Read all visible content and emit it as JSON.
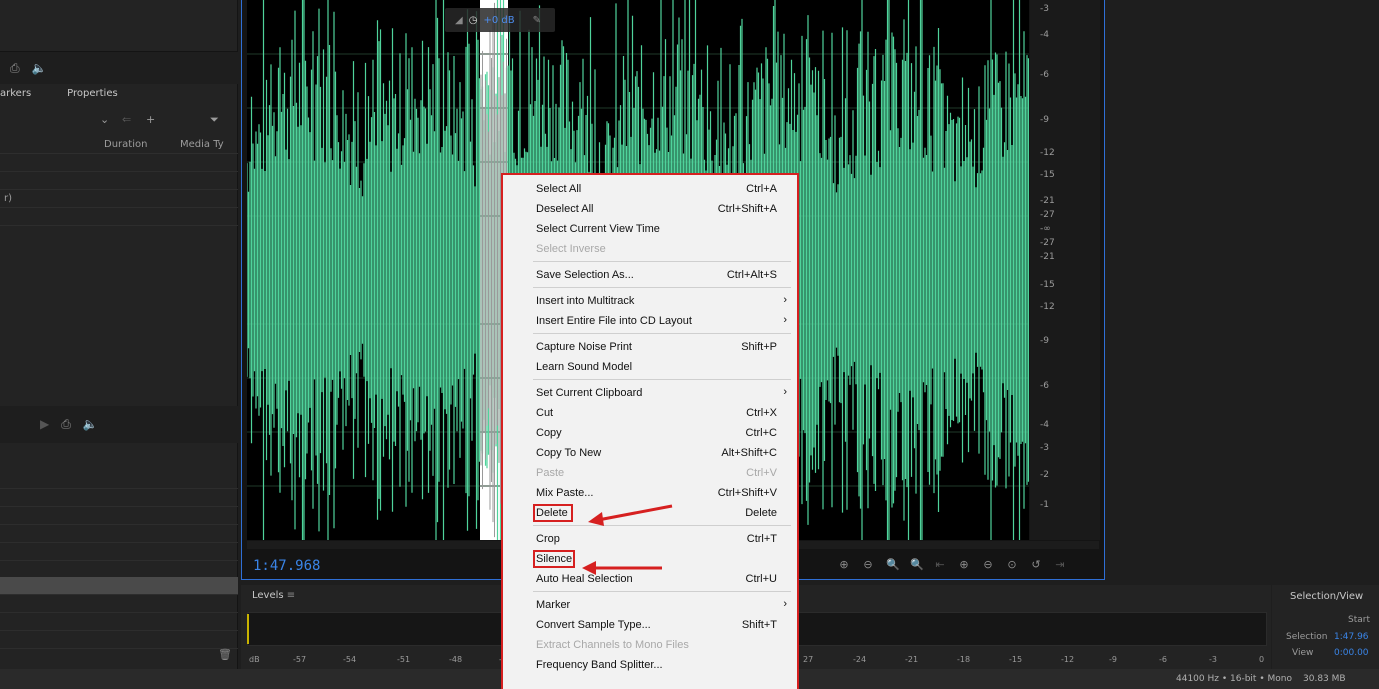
{
  "left_panel": {
    "tabs": [
      "arkers",
      "Properties"
    ],
    "columns": {
      "duration": "Duration",
      "media_type": "Media Ty"
    },
    "file_row_text": "r)"
  },
  "editor": {
    "hud_gain": "+0 dB",
    "timecode": "1:47.968",
    "ruler_labels": [
      "-3",
      "-4",
      "-6",
      "-9",
      "-12",
      "-15",
      "-21",
      "-27",
      "-∞",
      "-27",
      "-21",
      "-15",
      "-12",
      "-9",
      "-6",
      "-4",
      "-3",
      "-2",
      "-1"
    ],
    "waveform_color": "#4fd39b"
  },
  "levels": {
    "title": "Levels",
    "scale": [
      "dB",
      "-57",
      "-54",
      "-51",
      "-48",
      "-4",
      "27",
      "-24",
      "-21",
      "-18",
      "-15",
      "-12",
      "-9",
      "-6",
      "-3",
      "0"
    ]
  },
  "selection_view": {
    "title": "Selection/View",
    "start_header": "Start",
    "selection_label": "Selection",
    "selection_value": "1:47.96",
    "view_label": "View",
    "view_value": "0:00.00"
  },
  "status": {
    "format": "44100 Hz • 16-bit • Mono",
    "size": "30.83 MB"
  },
  "context_menu": {
    "items": [
      {
        "label": "Select All",
        "shortcut": "Ctrl+A",
        "enabled": true
      },
      {
        "label": "Deselect All",
        "shortcut": "Ctrl+Shift+A",
        "enabled": true
      },
      {
        "label": "Select Current View Time",
        "shortcut": "",
        "enabled": true
      },
      {
        "label": "Select Inverse",
        "shortcut": "",
        "enabled": false
      },
      {
        "label": "Save Selection As...",
        "shortcut": "Ctrl+Alt+S",
        "enabled": true
      },
      {
        "label": "Insert into Multitrack",
        "shortcut": "",
        "enabled": true,
        "submenu": true
      },
      {
        "label": "Insert Entire File into CD Layout",
        "shortcut": "",
        "enabled": true,
        "submenu": true
      },
      {
        "label": "Capture Noise Print",
        "shortcut": "Shift+P",
        "enabled": true
      },
      {
        "label": "Learn Sound Model",
        "shortcut": "",
        "enabled": true
      },
      {
        "label": "Set Current Clipboard",
        "shortcut": "",
        "enabled": true,
        "submenu": true
      },
      {
        "label": "Cut",
        "shortcut": "Ctrl+X",
        "enabled": true
      },
      {
        "label": "Copy",
        "shortcut": "Ctrl+C",
        "enabled": true
      },
      {
        "label": "Copy To New",
        "shortcut": "Alt+Shift+C",
        "enabled": true
      },
      {
        "label": "Paste",
        "shortcut": "Ctrl+V",
        "enabled": false
      },
      {
        "label": "Mix Paste...",
        "shortcut": "Ctrl+Shift+V",
        "enabled": true
      },
      {
        "label": "Delete",
        "shortcut": "Delete",
        "enabled": true,
        "highlighted": true
      },
      {
        "label": "Crop",
        "shortcut": "Ctrl+T",
        "enabled": true
      },
      {
        "label": "Silence",
        "shortcut": "",
        "enabled": true,
        "highlighted": true
      },
      {
        "label": "Auto Heal Selection",
        "shortcut": "Ctrl+U",
        "enabled": true
      },
      {
        "label": "Marker",
        "shortcut": "",
        "enabled": true,
        "submenu": true
      },
      {
        "label": "Convert Sample Type...",
        "shortcut": "Shift+T",
        "enabled": true
      },
      {
        "label": "Extract Channels to Mono Files",
        "shortcut": "",
        "enabled": false
      },
      {
        "label": "Frequency Band Splitter...",
        "shortcut": "",
        "enabled": true
      }
    ],
    "annotation_color": "#d62020"
  }
}
